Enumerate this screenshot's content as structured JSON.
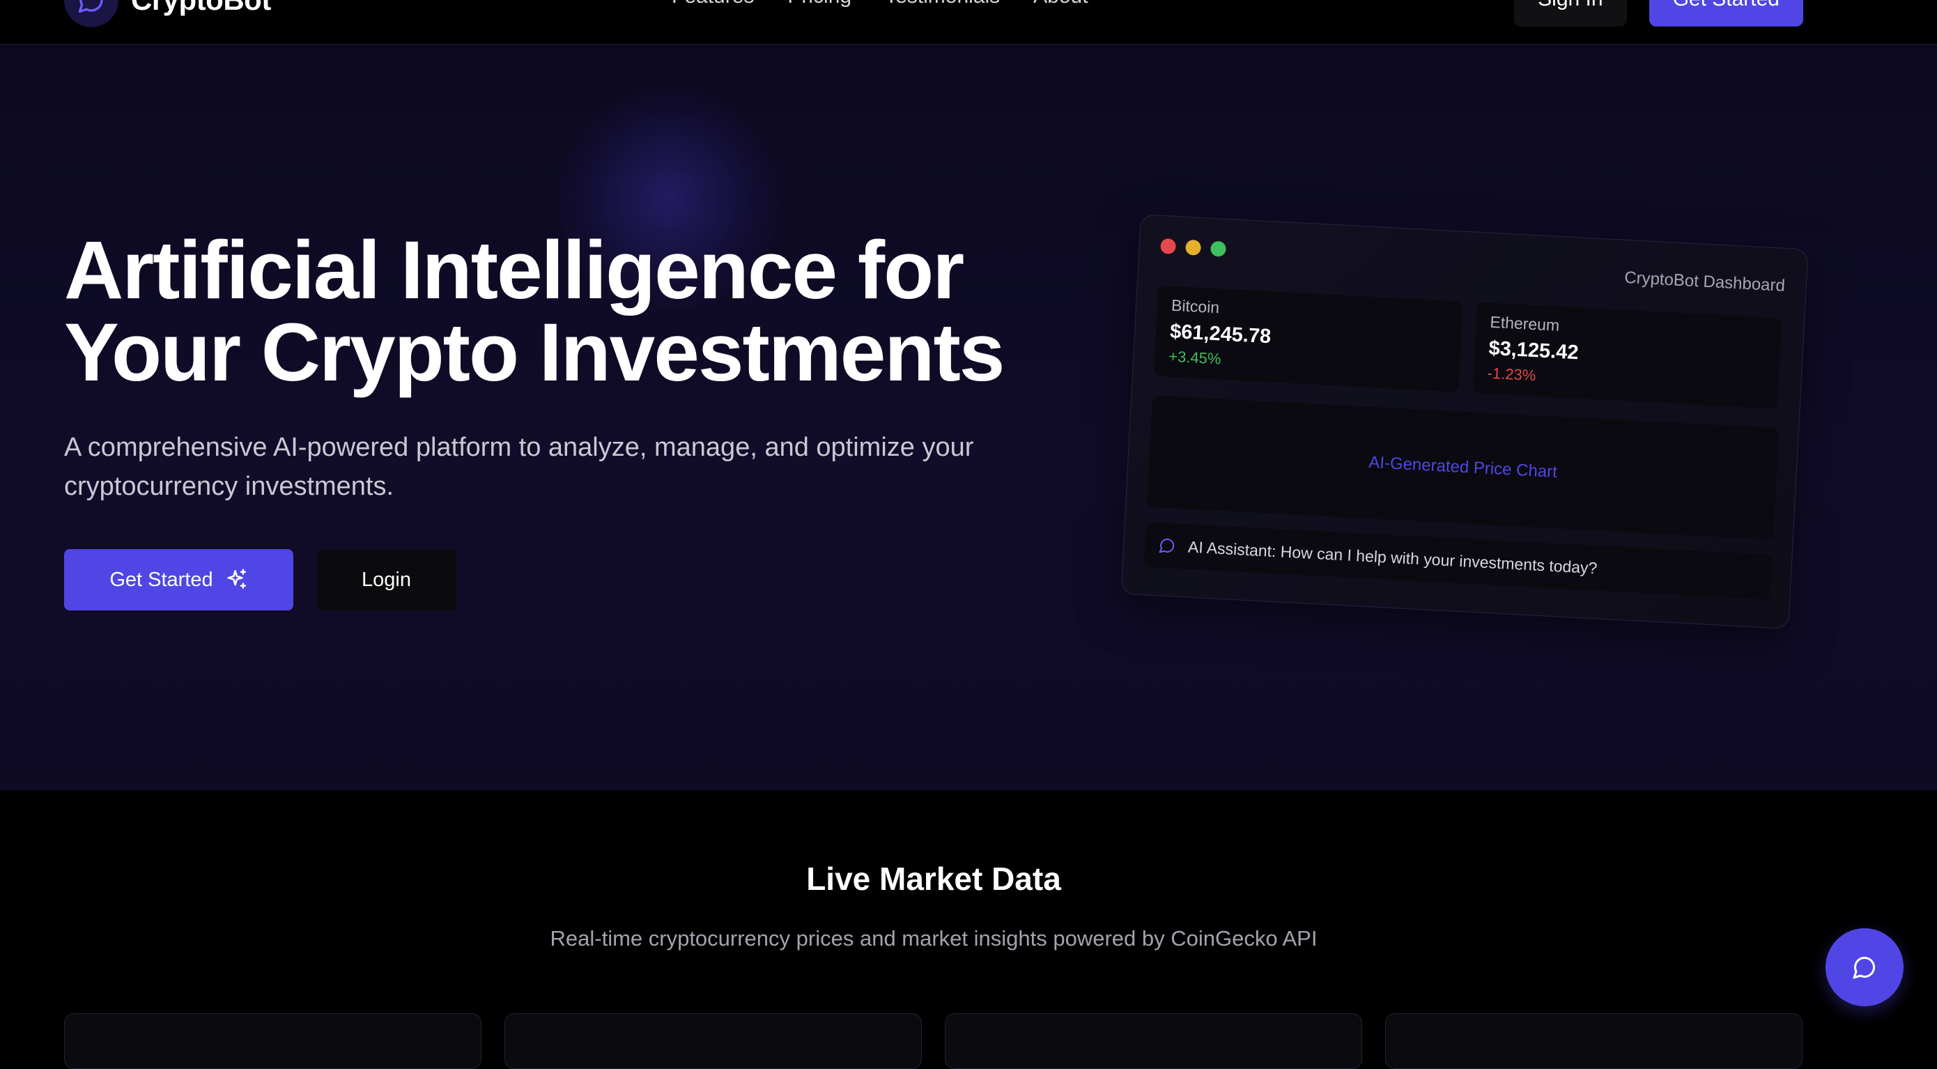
{
  "nav": {
    "brand": "CryptoBot",
    "links": [
      "Features",
      "Pricing",
      "Testimonials",
      "About"
    ],
    "sign_in": "Sign In",
    "get_started": "Get Started"
  },
  "hero": {
    "title_line1": "Artificial Intelligence for",
    "title_line2": "Your Crypto Investments",
    "subtitle": "A comprehensive AI-powered platform to analyze, manage, and optimize your cryptocurrency investments.",
    "primary_button": "Get Started",
    "secondary_button": "Login"
  },
  "dashboard": {
    "title": "CryptoBot Dashboard",
    "coins": [
      {
        "name": "Bitcoin",
        "price": "$61,245.78",
        "change": "+3.45%"
      },
      {
        "name": "Ethereum",
        "price": "$3,125.42",
        "change": "-1.23%"
      }
    ],
    "chart_label": "AI-Generated Price Chart",
    "assistant_text": "AI Assistant: How can I help with your investments today?"
  },
  "market": {
    "title": "Live Market Data",
    "subtitle": "Real-time cryptocurrency prices and market insights powered by CoinGecko API"
  },
  "colors": {
    "accent": "#5046e5",
    "positive": "#3fbf5f",
    "negative": "#e5484d"
  },
  "icons": {
    "brand_logo": "chat-bubble-icon",
    "sparkle": "sparkles-icon",
    "assistant": "chat-bubble-icon",
    "chat_fab": "chat-bubble-icon"
  }
}
